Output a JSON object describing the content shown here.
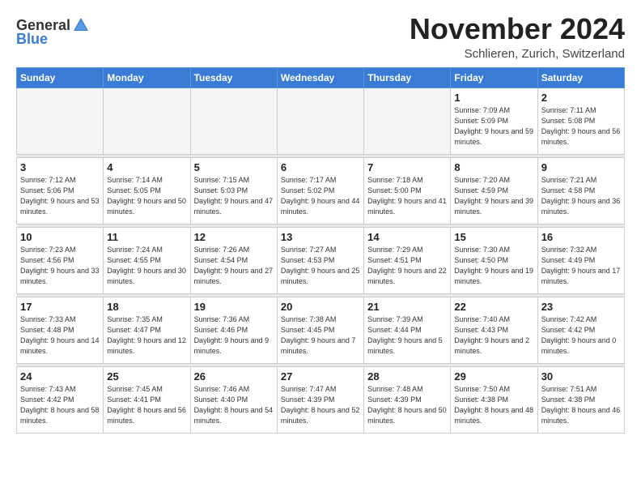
{
  "header": {
    "logo_general": "General",
    "logo_blue": "Blue",
    "month_title": "November 2024",
    "location": "Schlieren, Zurich, Switzerland"
  },
  "days_of_week": [
    "Sunday",
    "Monday",
    "Tuesday",
    "Wednesday",
    "Thursday",
    "Friday",
    "Saturday"
  ],
  "weeks": [
    [
      {
        "day": "",
        "info": ""
      },
      {
        "day": "",
        "info": ""
      },
      {
        "day": "",
        "info": ""
      },
      {
        "day": "",
        "info": ""
      },
      {
        "day": "",
        "info": ""
      },
      {
        "day": "1",
        "info": "Sunrise: 7:09 AM\nSunset: 5:09 PM\nDaylight: 9 hours and 59 minutes."
      },
      {
        "day": "2",
        "info": "Sunrise: 7:11 AM\nSunset: 5:08 PM\nDaylight: 9 hours and 56 minutes."
      }
    ],
    [
      {
        "day": "3",
        "info": "Sunrise: 7:12 AM\nSunset: 5:06 PM\nDaylight: 9 hours and 53 minutes."
      },
      {
        "day": "4",
        "info": "Sunrise: 7:14 AM\nSunset: 5:05 PM\nDaylight: 9 hours and 50 minutes."
      },
      {
        "day": "5",
        "info": "Sunrise: 7:15 AM\nSunset: 5:03 PM\nDaylight: 9 hours and 47 minutes."
      },
      {
        "day": "6",
        "info": "Sunrise: 7:17 AM\nSunset: 5:02 PM\nDaylight: 9 hours and 44 minutes."
      },
      {
        "day": "7",
        "info": "Sunrise: 7:18 AM\nSunset: 5:00 PM\nDaylight: 9 hours and 41 minutes."
      },
      {
        "day": "8",
        "info": "Sunrise: 7:20 AM\nSunset: 4:59 PM\nDaylight: 9 hours and 39 minutes."
      },
      {
        "day": "9",
        "info": "Sunrise: 7:21 AM\nSunset: 4:58 PM\nDaylight: 9 hours and 36 minutes."
      }
    ],
    [
      {
        "day": "10",
        "info": "Sunrise: 7:23 AM\nSunset: 4:56 PM\nDaylight: 9 hours and 33 minutes."
      },
      {
        "day": "11",
        "info": "Sunrise: 7:24 AM\nSunset: 4:55 PM\nDaylight: 9 hours and 30 minutes."
      },
      {
        "day": "12",
        "info": "Sunrise: 7:26 AM\nSunset: 4:54 PM\nDaylight: 9 hours and 27 minutes."
      },
      {
        "day": "13",
        "info": "Sunrise: 7:27 AM\nSunset: 4:53 PM\nDaylight: 9 hours and 25 minutes."
      },
      {
        "day": "14",
        "info": "Sunrise: 7:29 AM\nSunset: 4:51 PM\nDaylight: 9 hours and 22 minutes."
      },
      {
        "day": "15",
        "info": "Sunrise: 7:30 AM\nSunset: 4:50 PM\nDaylight: 9 hours and 19 minutes."
      },
      {
        "day": "16",
        "info": "Sunrise: 7:32 AM\nSunset: 4:49 PM\nDaylight: 9 hours and 17 minutes."
      }
    ],
    [
      {
        "day": "17",
        "info": "Sunrise: 7:33 AM\nSunset: 4:48 PM\nDaylight: 9 hours and 14 minutes."
      },
      {
        "day": "18",
        "info": "Sunrise: 7:35 AM\nSunset: 4:47 PM\nDaylight: 9 hours and 12 minutes."
      },
      {
        "day": "19",
        "info": "Sunrise: 7:36 AM\nSunset: 4:46 PM\nDaylight: 9 hours and 9 minutes."
      },
      {
        "day": "20",
        "info": "Sunrise: 7:38 AM\nSunset: 4:45 PM\nDaylight: 9 hours and 7 minutes."
      },
      {
        "day": "21",
        "info": "Sunrise: 7:39 AM\nSunset: 4:44 PM\nDaylight: 9 hours and 5 minutes."
      },
      {
        "day": "22",
        "info": "Sunrise: 7:40 AM\nSunset: 4:43 PM\nDaylight: 9 hours and 2 minutes."
      },
      {
        "day": "23",
        "info": "Sunrise: 7:42 AM\nSunset: 4:42 PM\nDaylight: 9 hours and 0 minutes."
      }
    ],
    [
      {
        "day": "24",
        "info": "Sunrise: 7:43 AM\nSunset: 4:42 PM\nDaylight: 8 hours and 58 minutes."
      },
      {
        "day": "25",
        "info": "Sunrise: 7:45 AM\nSunset: 4:41 PM\nDaylight: 8 hours and 56 minutes."
      },
      {
        "day": "26",
        "info": "Sunrise: 7:46 AM\nSunset: 4:40 PM\nDaylight: 8 hours and 54 minutes."
      },
      {
        "day": "27",
        "info": "Sunrise: 7:47 AM\nSunset: 4:39 PM\nDaylight: 8 hours and 52 minutes."
      },
      {
        "day": "28",
        "info": "Sunrise: 7:48 AM\nSunset: 4:39 PM\nDaylight: 8 hours and 50 minutes."
      },
      {
        "day": "29",
        "info": "Sunrise: 7:50 AM\nSunset: 4:38 PM\nDaylight: 8 hours and 48 minutes."
      },
      {
        "day": "30",
        "info": "Sunrise: 7:51 AM\nSunset: 4:38 PM\nDaylight: 8 hours and 46 minutes."
      }
    ]
  ]
}
